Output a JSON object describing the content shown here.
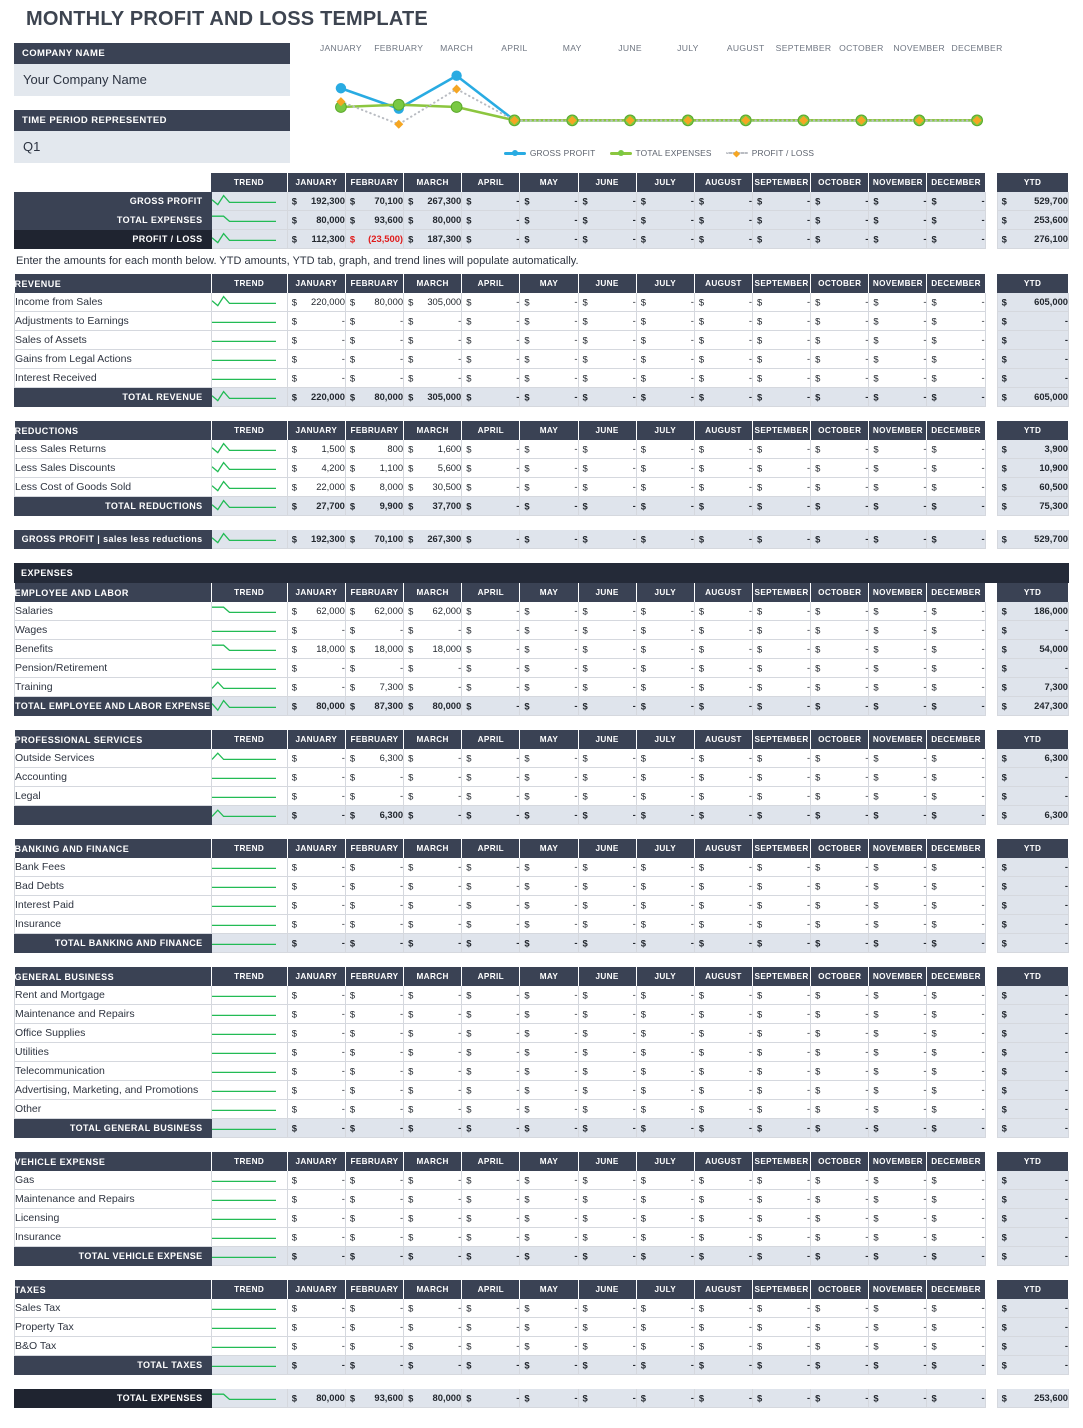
{
  "title": "MONTHLY PROFIT AND LOSS TEMPLATE",
  "fields": {
    "company_label": "COMPANY NAME",
    "company_value": "Your Company Name",
    "period_label": "TIME PERIOD REPRESENTED",
    "period_value": "Q1"
  },
  "months": [
    "JANUARY",
    "FEBRUARY",
    "MARCH",
    "APRIL",
    "MAY",
    "JUNE",
    "JULY",
    "AUGUST",
    "SEPTEMBER",
    "OCTOBER",
    "NOVEMBER",
    "DECEMBER"
  ],
  "columns": {
    "trend": "TREND",
    "ytd": "YTD"
  },
  "note": "Enter the amounts for each month below. YTD amounts, YTD tab, graph, and trend lines will populate automatically.",
  "expenses_banner": "EXPENSES",
  "colors": {
    "header_navy": "#3a4254",
    "banner_black": "#242a38",
    "total_fill": "#dfe4ec",
    "input_fill": "#e3e8ee",
    "gross_profit": "#29abe2",
    "total_expenses": "#8cc63f",
    "profit_loss": "#f5a623",
    "profit_loss_line": "#b9bcc2",
    "sparkline": "#22bb55",
    "negative": "#e01b1b"
  },
  "chart_data": {
    "type": "line",
    "title": "",
    "xlabel": "",
    "ylabel": "",
    "categories": [
      "JANUARY",
      "FEBRUARY",
      "MARCH",
      "APRIL",
      "MAY",
      "JUNE",
      "JULY",
      "AUGUST",
      "SEPTEMBER",
      "OCTOBER",
      "NOVEMBER",
      "DECEMBER"
    ],
    "legend_position": "bottom",
    "grid": false,
    "series": [
      {
        "name": "GROSS PROFIT",
        "color": "#29abe2",
        "marker": "circle",
        "values": [
          192300,
          70100,
          267300,
          0,
          0,
          0,
          0,
          0,
          0,
          0,
          0,
          0
        ]
      },
      {
        "name": "TOTAL EXPENSES",
        "color": "#8cc63f",
        "marker": "circle",
        "values": [
          80000,
          93600,
          80000,
          0,
          0,
          0,
          0,
          0,
          0,
          0,
          0,
          0
        ]
      },
      {
        "name": "PROFIT / LOSS",
        "color": "#f5a623",
        "marker": "diamond",
        "style": "dotted",
        "values": [
          112300,
          -23500,
          187300,
          0,
          0,
          0,
          0,
          0,
          0,
          0,
          0,
          0
        ]
      }
    ]
  },
  "summary": {
    "rows": [
      {
        "label": "GROSS PROFIT",
        "style": "dark",
        "values": [
          "192,300",
          "70,100",
          "267,300",
          "-",
          "-",
          "-",
          "-",
          "-",
          "-",
          "-",
          "-",
          "-"
        ],
        "ytd": "529,700"
      },
      {
        "label": "TOTAL EXPENSES",
        "style": "dark",
        "values": [
          "80,000",
          "93,600",
          "80,000",
          "-",
          "-",
          "-",
          "-",
          "-",
          "-",
          "-",
          "-",
          "-"
        ],
        "ytd": "253,600"
      },
      {
        "label": "PROFIT / LOSS",
        "style": "black",
        "values": [
          "112,300",
          "(23,500)",
          "187,300",
          "-",
          "-",
          "-",
          "-",
          "-",
          "-",
          "-",
          "-",
          "-"
        ],
        "negatives": [
          1
        ],
        "ytd": "276,100"
      }
    ]
  },
  "sections": [
    {
      "header": "REVENUE",
      "rows": [
        {
          "label": "Income from Sales",
          "values": [
            "220,000",
            "80,000",
            "305,000",
            "-",
            "-",
            "-",
            "-",
            "-",
            "-",
            "-",
            "-",
            "-"
          ],
          "ytd": "605,000"
        },
        {
          "label": "Adjustments to Earnings",
          "values": [
            "-",
            "-",
            "-",
            "-",
            "-",
            "-",
            "-",
            "-",
            "-",
            "-",
            "-",
            "-"
          ],
          "ytd": "-"
        },
        {
          "label": "Sales of Assets",
          "values": [
            "-",
            "-",
            "-",
            "-",
            "-",
            "-",
            "-",
            "-",
            "-",
            "-",
            "-",
            "-"
          ],
          "ytd": "-"
        },
        {
          "label": "Gains from Legal Actions",
          "values": [
            "-",
            "-",
            "-",
            "-",
            "-",
            "-",
            "-",
            "-",
            "-",
            "-",
            "-",
            "-"
          ],
          "ytd": "-"
        },
        {
          "label": "Interest Received",
          "values": [
            "-",
            "-",
            "-",
            "-",
            "-",
            "-",
            "-",
            "-",
            "-",
            "-",
            "-",
            "-"
          ],
          "ytd": "-"
        }
      ],
      "total": {
        "label": "TOTAL REVENUE",
        "values": [
          "220,000",
          "80,000",
          "305,000",
          "-",
          "-",
          "-",
          "-",
          "-",
          "-",
          "-",
          "-",
          "-"
        ],
        "ytd": "605,000"
      }
    },
    {
      "header": "REDUCTIONS",
      "rows": [
        {
          "label": "Less Sales Returns",
          "values": [
            "1,500",
            "800",
            "1,600",
            "-",
            "-",
            "-",
            "-",
            "-",
            "-",
            "-",
            "-",
            "-"
          ],
          "ytd": "3,900"
        },
        {
          "label": "Less Sales Discounts",
          "values": [
            "4,200",
            "1,100",
            "5,600",
            "-",
            "-",
            "-",
            "-",
            "-",
            "-",
            "-",
            "-",
            "-"
          ],
          "ytd": "10,900"
        },
        {
          "label": "Less Cost of Goods Sold",
          "values": [
            "22,000",
            "8,000",
            "30,500",
            "-",
            "-",
            "-",
            "-",
            "-",
            "-",
            "-",
            "-",
            "-"
          ],
          "ytd": "60,500"
        }
      ],
      "total": {
        "label": "TOTAL REDUCTIONS",
        "values": [
          "27,700",
          "9,900",
          "37,700",
          "-",
          "-",
          "-",
          "-",
          "-",
          "-",
          "-",
          "-",
          "-"
        ],
        "ytd": "75,300"
      }
    }
  ],
  "gross_profit_bar": {
    "label": "GROSS PROFIT   |   sales less reductions",
    "values": [
      "192,300",
      "70,100",
      "267,300",
      "-",
      "-",
      "-",
      "-",
      "-",
      "-",
      "-",
      "-",
      "-"
    ],
    "ytd": "529,700"
  },
  "expense_sections": [
    {
      "header": "EMPLOYEE AND LABOR",
      "rows": [
        {
          "label": "Salaries",
          "values": [
            "62,000",
            "62,000",
            "62,000",
            "-",
            "-",
            "-",
            "-",
            "-",
            "-",
            "-",
            "-",
            "-"
          ],
          "ytd": "186,000"
        },
        {
          "label": "Wages",
          "values": [
            "-",
            "-",
            "-",
            "-",
            "-",
            "-",
            "-",
            "-",
            "-",
            "-",
            "-",
            "-"
          ],
          "ytd": "-"
        },
        {
          "label": "Benefits",
          "values": [
            "18,000",
            "18,000",
            "18,000",
            "-",
            "-",
            "-",
            "-",
            "-",
            "-",
            "-",
            "-",
            "-"
          ],
          "ytd": "54,000"
        },
        {
          "label": "Pension/Retirement",
          "values": [
            "-",
            "-",
            "-",
            "-",
            "-",
            "-",
            "-",
            "-",
            "-",
            "-",
            "-",
            "-"
          ],
          "ytd": "-"
        },
        {
          "label": "Training",
          "values": [
            "-",
            "7,300",
            "-",
            "-",
            "-",
            "-",
            "-",
            "-",
            "-",
            "-",
            "-",
            "-"
          ],
          "ytd": "7,300"
        }
      ],
      "total": {
        "label": "TOTAL EMPLOYEE AND LABOR EXPENSE",
        "values": [
          "80,000",
          "87,300",
          "80,000",
          "-",
          "-",
          "-",
          "-",
          "-",
          "-",
          "-",
          "-",
          "-"
        ],
        "ytd": "247,300"
      }
    },
    {
      "header": "PROFESSIONAL SERVICES",
      "rows": [
        {
          "label": "Outside Services",
          "values": [
            "-",
            "6,300",
            "-",
            "-",
            "-",
            "-",
            "-",
            "-",
            "-",
            "-",
            "-",
            "-"
          ],
          "ytd": "6,300"
        },
        {
          "label": "Accounting",
          "values": [
            "-",
            "-",
            "-",
            "-",
            "-",
            "-",
            "-",
            "-",
            "-",
            "-",
            "-",
            "-"
          ],
          "ytd": "-"
        },
        {
          "label": "Legal",
          "values": [
            "-",
            "-",
            "-",
            "-",
            "-",
            "-",
            "-",
            "-",
            "-",
            "-",
            "-",
            "-"
          ],
          "ytd": "-"
        }
      ],
      "total": {
        "label": "",
        "values": [
          "-",
          "6,300",
          "-",
          "-",
          "-",
          "-",
          "-",
          "-",
          "-",
          "-",
          "-",
          "-"
        ],
        "ytd": "6,300"
      }
    },
    {
      "header": "BANKING AND FINANCE",
      "rows": [
        {
          "label": "Bank Fees",
          "values": [
            "-",
            "-",
            "-",
            "-",
            "-",
            "-",
            "-",
            "-",
            "-",
            "-",
            "-",
            "-"
          ],
          "ytd": "-"
        },
        {
          "label": "Bad Debts",
          "values": [
            "-",
            "-",
            "-",
            "-",
            "-",
            "-",
            "-",
            "-",
            "-",
            "-",
            "-",
            "-"
          ],
          "ytd": "-"
        },
        {
          "label": "Interest Paid",
          "values": [
            "-",
            "-",
            "-",
            "-",
            "-",
            "-",
            "-",
            "-",
            "-",
            "-",
            "-",
            "-"
          ],
          "ytd": "-"
        },
        {
          "label": "Insurance",
          "values": [
            "-",
            "-",
            "-",
            "-",
            "-",
            "-",
            "-",
            "-",
            "-",
            "-",
            "-",
            "-"
          ],
          "ytd": "-"
        }
      ],
      "total": {
        "label": "TOTAL BANKING AND FINANCE",
        "values": [
          "-",
          "-",
          "-",
          "-",
          "-",
          "-",
          "-",
          "-",
          "-",
          "-",
          "-",
          "-"
        ],
        "ytd": "-"
      }
    },
    {
      "header": "GENERAL BUSINESS",
      "rows": [
        {
          "label": "Rent and Mortgage",
          "values": [
            "-",
            "-",
            "-",
            "-",
            "-",
            "-",
            "-",
            "-",
            "-",
            "-",
            "-",
            "-"
          ],
          "ytd": "-"
        },
        {
          "label": "Maintenance and Repairs",
          "values": [
            "-",
            "-",
            "-",
            "-",
            "-",
            "-",
            "-",
            "-",
            "-",
            "-",
            "-",
            "-"
          ],
          "ytd": "-"
        },
        {
          "label": "Office Supplies",
          "values": [
            "-",
            "-",
            "-",
            "-",
            "-",
            "-",
            "-",
            "-",
            "-",
            "-",
            "-",
            "-"
          ],
          "ytd": "-"
        },
        {
          "label": "Utilities",
          "values": [
            "-",
            "-",
            "-",
            "-",
            "-",
            "-",
            "-",
            "-",
            "-",
            "-",
            "-",
            "-"
          ],
          "ytd": "-"
        },
        {
          "label": "Telecommunication",
          "values": [
            "-",
            "-",
            "-",
            "-",
            "-",
            "-",
            "-",
            "-",
            "-",
            "-",
            "-",
            "-"
          ],
          "ytd": "-"
        },
        {
          "label": "Advertising, Marketing, and Promotions",
          "values": [
            "-",
            "-",
            "-",
            "-",
            "-",
            "-",
            "-",
            "-",
            "-",
            "-",
            "-",
            "-"
          ],
          "ytd": "-"
        },
        {
          "label": "Other",
          "values": [
            "-",
            "-",
            "-",
            "-",
            "-",
            "-",
            "-",
            "-",
            "-",
            "-",
            "-",
            "-"
          ],
          "ytd": "-"
        }
      ],
      "total": {
        "label": "TOTAL GENERAL BUSINESS",
        "values": [
          "-",
          "-",
          "-",
          "-",
          "-",
          "-",
          "-",
          "-",
          "-",
          "-",
          "-",
          "-"
        ],
        "ytd": "-"
      }
    },
    {
      "header": "VEHICLE EXPENSE",
      "rows": [
        {
          "label": "Gas",
          "values": [
            "-",
            "-",
            "-",
            "-",
            "-",
            "-",
            "-",
            "-",
            "-",
            "-",
            "-",
            "-"
          ],
          "ytd": "-"
        },
        {
          "label": "Maintenance and Repairs",
          "values": [
            "-",
            "-",
            "-",
            "-",
            "-",
            "-",
            "-",
            "-",
            "-",
            "-",
            "-",
            "-"
          ],
          "ytd": "-"
        },
        {
          "label": "Licensing",
          "values": [
            "-",
            "-",
            "-",
            "-",
            "-",
            "-",
            "-",
            "-",
            "-",
            "-",
            "-",
            "-"
          ],
          "ytd": "-"
        },
        {
          "label": "Insurance",
          "values": [
            "-",
            "-",
            "-",
            "-",
            "-",
            "-",
            "-",
            "-",
            "-",
            "-",
            "-",
            "-"
          ],
          "ytd": "-"
        }
      ],
      "total": {
        "label": "TOTAL VEHICLE EXPENSE",
        "values": [
          "-",
          "-",
          "-",
          "-",
          "-",
          "-",
          "-",
          "-",
          "-",
          "-",
          "-",
          "-"
        ],
        "ytd": "-"
      }
    },
    {
      "header": "TAXES",
      "rows": [
        {
          "label": "Sales Tax",
          "values": [
            "-",
            "-",
            "-",
            "-",
            "-",
            "-",
            "-",
            "-",
            "-",
            "-",
            "-",
            "-"
          ],
          "ytd": "-"
        },
        {
          "label": "Property Tax",
          "values": [
            "-",
            "-",
            "-",
            "-",
            "-",
            "-",
            "-",
            "-",
            "-",
            "-",
            "-",
            "-"
          ],
          "ytd": "-"
        },
        {
          "label": "B&O Tax",
          "values": [
            "-",
            "-",
            "-",
            "-",
            "-",
            "-",
            "-",
            "-",
            "-",
            "-",
            "-",
            "-"
          ],
          "ytd": "-"
        }
      ],
      "total": {
        "label": "TOTAL TAXES",
        "values": [
          "-",
          "-",
          "-",
          "-",
          "-",
          "-",
          "-",
          "-",
          "-",
          "-",
          "-",
          "-"
        ],
        "ytd": "-"
      }
    }
  ],
  "total_expenses_bar": {
    "label": "TOTAL EXPENSES",
    "values": [
      "80,000",
      "93,600",
      "80,000",
      "-",
      "-",
      "-",
      "-",
      "-",
      "-",
      "-",
      "-",
      "-"
    ],
    "ytd": "253,600"
  },
  "sparkline_shapes": {
    "peak_dip": [
      0.3,
      0.85,
      0.05,
      0.62,
      0.62,
      0.62,
      0.62,
      0.62,
      0.62,
      0.62,
      0.62,
      0.62
    ],
    "flat": [
      0.62,
      0.62,
      0.62,
      0.62,
      0.62,
      0.62,
      0.62,
      0.62,
      0.62,
      0.62,
      0.62,
      0.62
    ],
    "step_down": [
      0.18,
      0.18,
      0.18,
      0.62,
      0.62,
      0.62,
      0.62,
      0.62,
      0.62,
      0.62,
      0.62,
      0.62
    ],
    "bump": [
      0.62,
      0.1,
      0.62,
      0.62,
      0.62,
      0.62,
      0.62,
      0.62,
      0.62,
      0.62,
      0.62,
      0.62
    ],
    "v_up": [
      0.4,
      0.8,
      0.05,
      0.62,
      0.62,
      0.62,
      0.62,
      0.62,
      0.62,
      0.62,
      0.62,
      0.62
    ]
  }
}
